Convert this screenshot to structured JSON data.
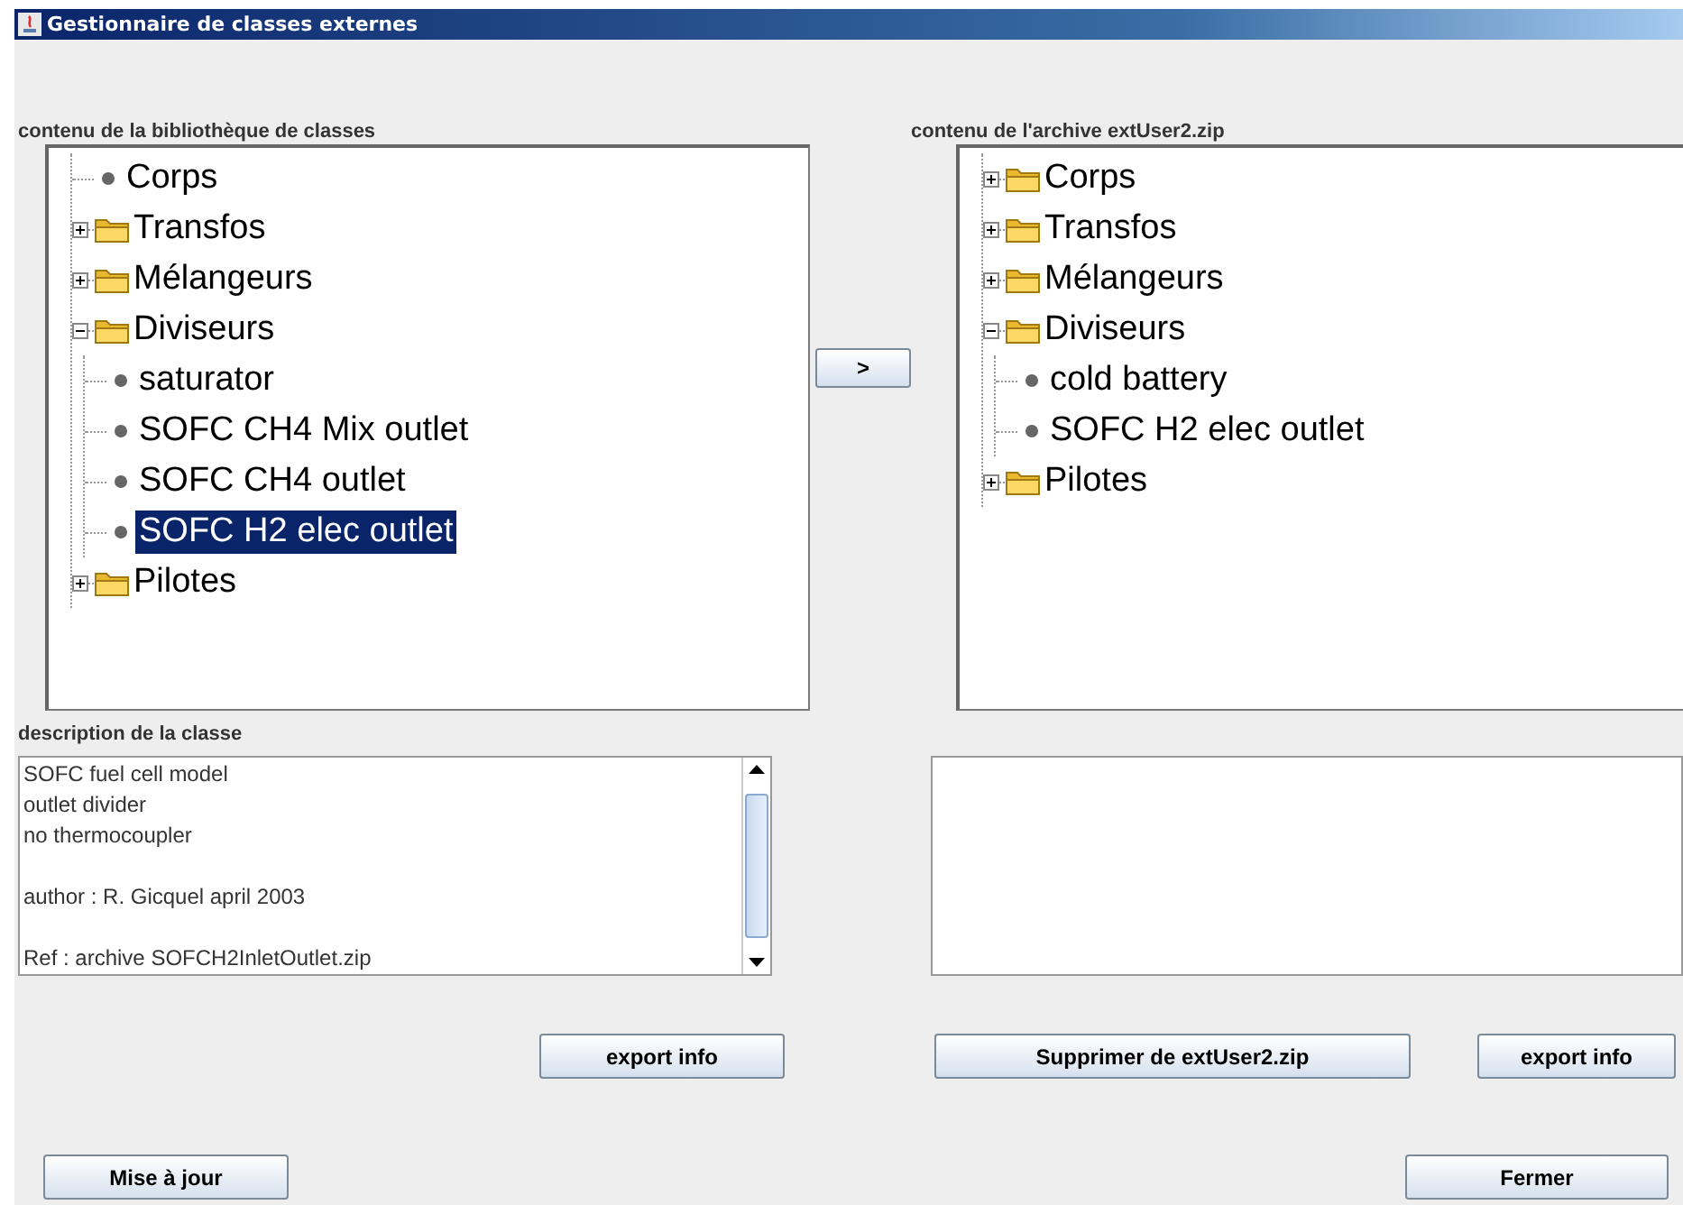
{
  "window": {
    "title": "Gestionnaire de classes externes"
  },
  "library": {
    "label": "contenu de la bibliothèque de classes",
    "tree": [
      {
        "label": "Corps",
        "kind": "leaf",
        "selected": false
      },
      {
        "label": "Transfos",
        "kind": "folder",
        "expanded": false,
        "selected": false
      },
      {
        "label": "Mélangeurs",
        "kind": "folder",
        "expanded": false,
        "selected": false
      },
      {
        "label": "Diviseurs",
        "kind": "folder",
        "expanded": true,
        "selected": false,
        "children": [
          {
            "label": "saturator",
            "kind": "leaf",
            "selected": false
          },
          {
            "label": "SOFC CH4 Mix outlet",
            "kind": "leaf",
            "selected": false
          },
          {
            "label": "SOFC CH4 outlet",
            "kind": "leaf",
            "selected": false
          },
          {
            "label": "SOFC H2 elec outlet",
            "kind": "leaf",
            "selected": true
          }
        ]
      },
      {
        "label": "Pilotes",
        "kind": "folder",
        "expanded": false,
        "selected": false
      }
    ]
  },
  "transfer_button": ">",
  "archive": {
    "label": "contenu de l'archive extUser2.zip",
    "tree": [
      {
        "label": "Corps",
        "kind": "folder",
        "expanded": false,
        "selected": false
      },
      {
        "label": "Transfos",
        "kind": "folder",
        "expanded": false,
        "selected": false
      },
      {
        "label": "Mélangeurs",
        "kind": "folder",
        "expanded": false,
        "selected": false
      },
      {
        "label": "Diviseurs",
        "kind": "folder",
        "expanded": true,
        "selected": false,
        "children": [
          {
            "label": "cold battery",
            "kind": "leaf",
            "selected": false
          },
          {
            "label": "SOFC H2 elec outlet",
            "kind": "leaf",
            "selected": false
          }
        ]
      },
      {
        "label": "Pilotes",
        "kind": "folder",
        "expanded": false,
        "selected": false
      }
    ]
  },
  "description": {
    "label": "description de la classe",
    "paragraphs": [
      [
        "SOFC fuel cell model",
        "outlet divider",
        "no thermocoupler"
      ],
      [
        "author : R. Gicquel april 2003"
      ],
      [
        "Ref : archive SOFCH2InletOutlet.zip"
      ]
    ]
  },
  "buttons": {
    "export_left": "export info",
    "delete": "Supprimer de extUser2.zip",
    "export_right": "export info",
    "update": "Mise à jour",
    "close": "Fermer"
  }
}
